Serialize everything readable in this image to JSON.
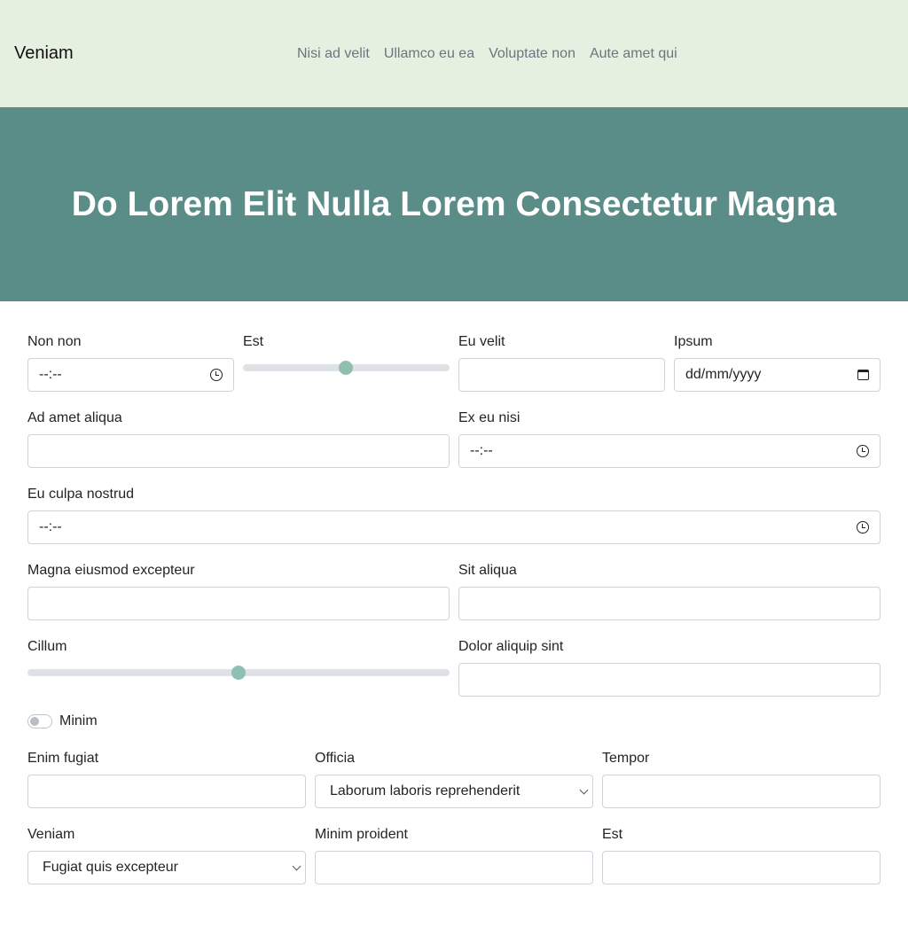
{
  "navbar": {
    "brand": "Veniam",
    "links": [
      "Nisi ad velit",
      "Ullamco eu ea",
      "Voluptate non",
      "Aute amet qui"
    ]
  },
  "hero": {
    "title": "Do Lorem Elit Nulla Lorem Consectetur Magna"
  },
  "form": {
    "non_non": {
      "label": "Non non",
      "value": "--:--"
    },
    "est_range": {
      "label": "Est",
      "value_fraction": 0.5
    },
    "eu_velit": {
      "label": "Eu velit",
      "value": ""
    },
    "ipsum": {
      "label": "Ipsum",
      "value": "dd/mm/yyyy"
    },
    "ad_amet_aliqua": {
      "label": "Ad amet aliqua",
      "value": ""
    },
    "ex_eu_nisi": {
      "label": "Ex eu nisi",
      "value": "--:--"
    },
    "eu_culpa_nostrud": {
      "label": "Eu culpa nostrud",
      "value": "--:--"
    },
    "magna_eiusmod_excepteur": {
      "label": "Magna eiusmod excepteur",
      "value": ""
    },
    "sit_aliqua": {
      "label": "Sit aliqua",
      "value": ""
    },
    "cillum_range": {
      "label": "Cillum",
      "value_fraction": 0.5
    },
    "dolor_aliquip_sint": {
      "label": "Dolor aliquip sint",
      "value": ""
    },
    "minim_switch": {
      "label": "Minim",
      "checked": false
    },
    "enim_fugiat": {
      "label": "Enim fugiat",
      "value": ""
    },
    "officia": {
      "label": "Officia",
      "selected": "Laborum laboris reprehenderit"
    },
    "tempor": {
      "label": "Tempor",
      "value": ""
    },
    "veniam": {
      "label": "Veniam",
      "selected": "Fugiat quis excepteur"
    },
    "minim_proident": {
      "label": "Minim proident",
      "value": ""
    },
    "est_text": {
      "label": "Est",
      "value": ""
    }
  },
  "colors": {
    "navbar_bg": "#e6f0e0",
    "hero_bg": "#5a8c88",
    "range_thumb": "#8fbfb0"
  }
}
